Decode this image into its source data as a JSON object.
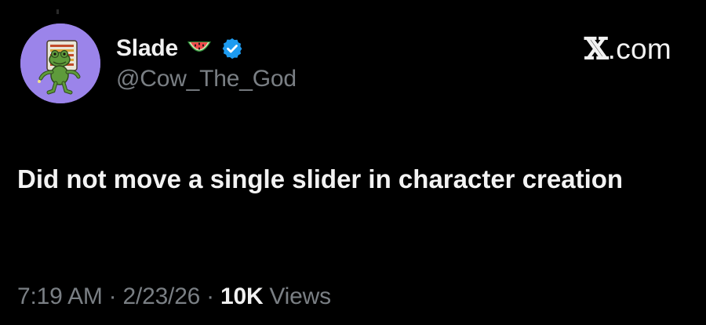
{
  "author": {
    "display_name": "Slade",
    "handle": "@Cow_The_God",
    "name_emoji": "watermelon-icon",
    "verified": true,
    "verified_color": "#1d9bf0"
  },
  "brand": {
    "x_glyph": "𝕏",
    "suffix": ".com"
  },
  "tweet": {
    "text": "Did not move a single slider in character creation"
  },
  "meta": {
    "time": "7:19 AM",
    "separator": "·",
    "date": "2/23/26",
    "views_count": "10K",
    "views_label": "Views"
  },
  "colors": {
    "background": "#000000",
    "primary_text": "#e7e9ea",
    "secondary_text": "#7a7f84",
    "avatar_bg": "#9b84ea"
  }
}
